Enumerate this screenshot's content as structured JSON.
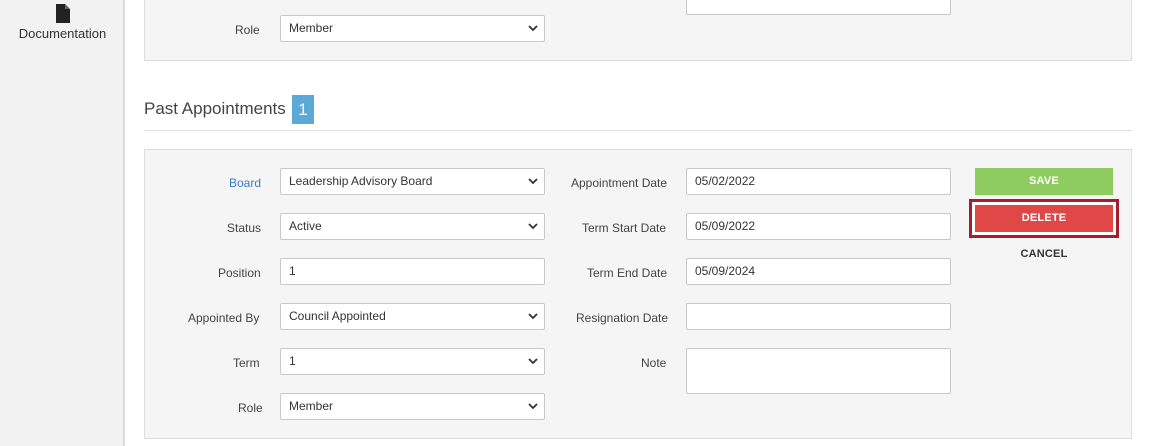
{
  "sidebar": {
    "items": [
      {
        "label": "Documentation",
        "icon": "document-icon"
      }
    ]
  },
  "top_panel": {
    "role_label": "Role",
    "role_value": "Member"
  },
  "past_appointments": {
    "title": "Past Appointments",
    "count": "1",
    "form": {
      "board_label": "Board",
      "board_value": "Leadership Advisory Board",
      "status_label": "Status",
      "status_value": "Active",
      "position_label": "Position",
      "position_value": "1",
      "appointed_by_label": "Appointed By",
      "appointed_by_value": "Council Appointed",
      "term_label": "Term",
      "term_value": "1",
      "role_label": "Role",
      "role_value": "Member",
      "appointment_date_label": "Appointment Date",
      "appointment_date_value": "05/02/2022",
      "term_start_label": "Term Start Date",
      "term_start_value": "05/09/2022",
      "term_end_label": "Term End Date",
      "term_end_value": "05/09/2024",
      "resignation_label": "Resignation Date",
      "resignation_value": "",
      "note_label": "Note",
      "note_value": ""
    },
    "actions": {
      "save_label": "SAVE",
      "delete_label": "DELETE",
      "cancel_label": "CANCEL"
    }
  },
  "colors": {
    "save": "#8fcc5f",
    "delete": "#e04848",
    "delete_highlight": "#a41e2d",
    "badge": "#5aa9d6",
    "link": "#3a7ec2"
  }
}
